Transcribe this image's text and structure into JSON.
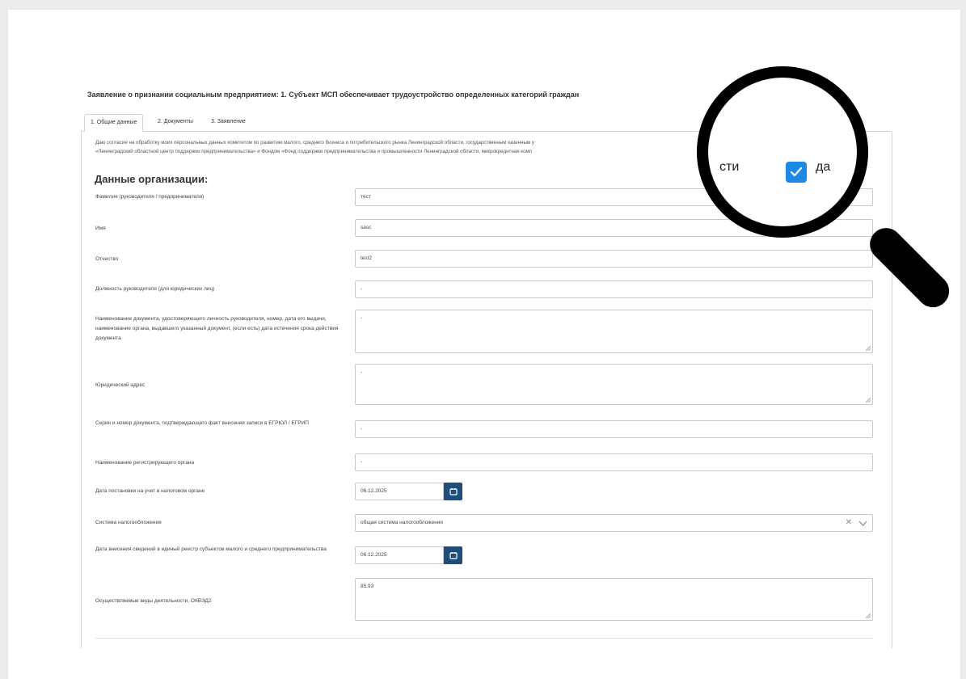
{
  "title": "Заявление о признании социальным предприятием: 1. Субъект МСП обеспечивает трудоустройство определенных категорий граждан",
  "tabs": [
    {
      "label": "1. Общие данные",
      "active": true
    },
    {
      "label": "2. Документы",
      "active": false
    },
    {
      "label": "3. Заявление",
      "active": false
    }
  ],
  "consent": {
    "line1": "Даю согласие на обработку моих персональных данных комитетом по развитию малого, среднего бизнеса и потребительского рынка Ленинградской области, государственным казенным у",
    "line2": "«Ленинградский областной центр поддержки предпринимательства» и Фондом «Фонд поддержки предпринимательства и промышленности Ленинградской области, микрокредитная комп"
  },
  "section_title": "Данные организации:",
  "fields": {
    "surname": {
      "label": "Фамилия (руководителя / предпринимателя)",
      "value": "тест"
    },
    "name": {
      "label": "Имя",
      "value": "sasc"
    },
    "patronymic": {
      "label": "Отчество",
      "value": "test2"
    },
    "position": {
      "label": "Должность руководителя (для юридических лиц)",
      "value": "-"
    },
    "id_document": {
      "label": "Наименование документа, удостоверяющего личность руководителя, номер, дата его выдачи, наименование органа, выдавшего указанный документ, (если есть) дата истечения срока действия документа",
      "value": "-"
    },
    "legal_address": {
      "label": "Юридический адрес",
      "value": "-"
    },
    "egrul_doc": {
      "label": "Серия и номер документа, подтверждающего факт внесения записи в ЕГРЮЛ / ЕГРИП",
      "value": "-"
    },
    "reg_authority": {
      "label": "Наименование регистрирующего органа",
      "value": "-"
    },
    "tax_date": {
      "label": "Дата постановки на учет в налоговом органе",
      "value": "06.12.2025"
    },
    "tax_system": {
      "label": "Система налогообложения",
      "value": "общая система налогообложения"
    },
    "registry_date": {
      "label": "Дата внесения сведений в единый реестр субъектов малого и среднего предпринимательства",
      "value": "06.12.2025"
    },
    "okved": {
      "label": "Осуществляемые виды деятельности, ОКВЭД2",
      "value": "85.93"
    }
  },
  "magnifier": {
    "left_text": "сти",
    "checkbox_label": "да",
    "checked": true,
    "check_color": "#1e88e5"
  },
  "icons": {
    "calendar": "calendar-icon",
    "clear": "clear-icon",
    "chevron": "chevron-down-icon"
  },
  "colors": {
    "date_button": "#1f4e7a"
  }
}
